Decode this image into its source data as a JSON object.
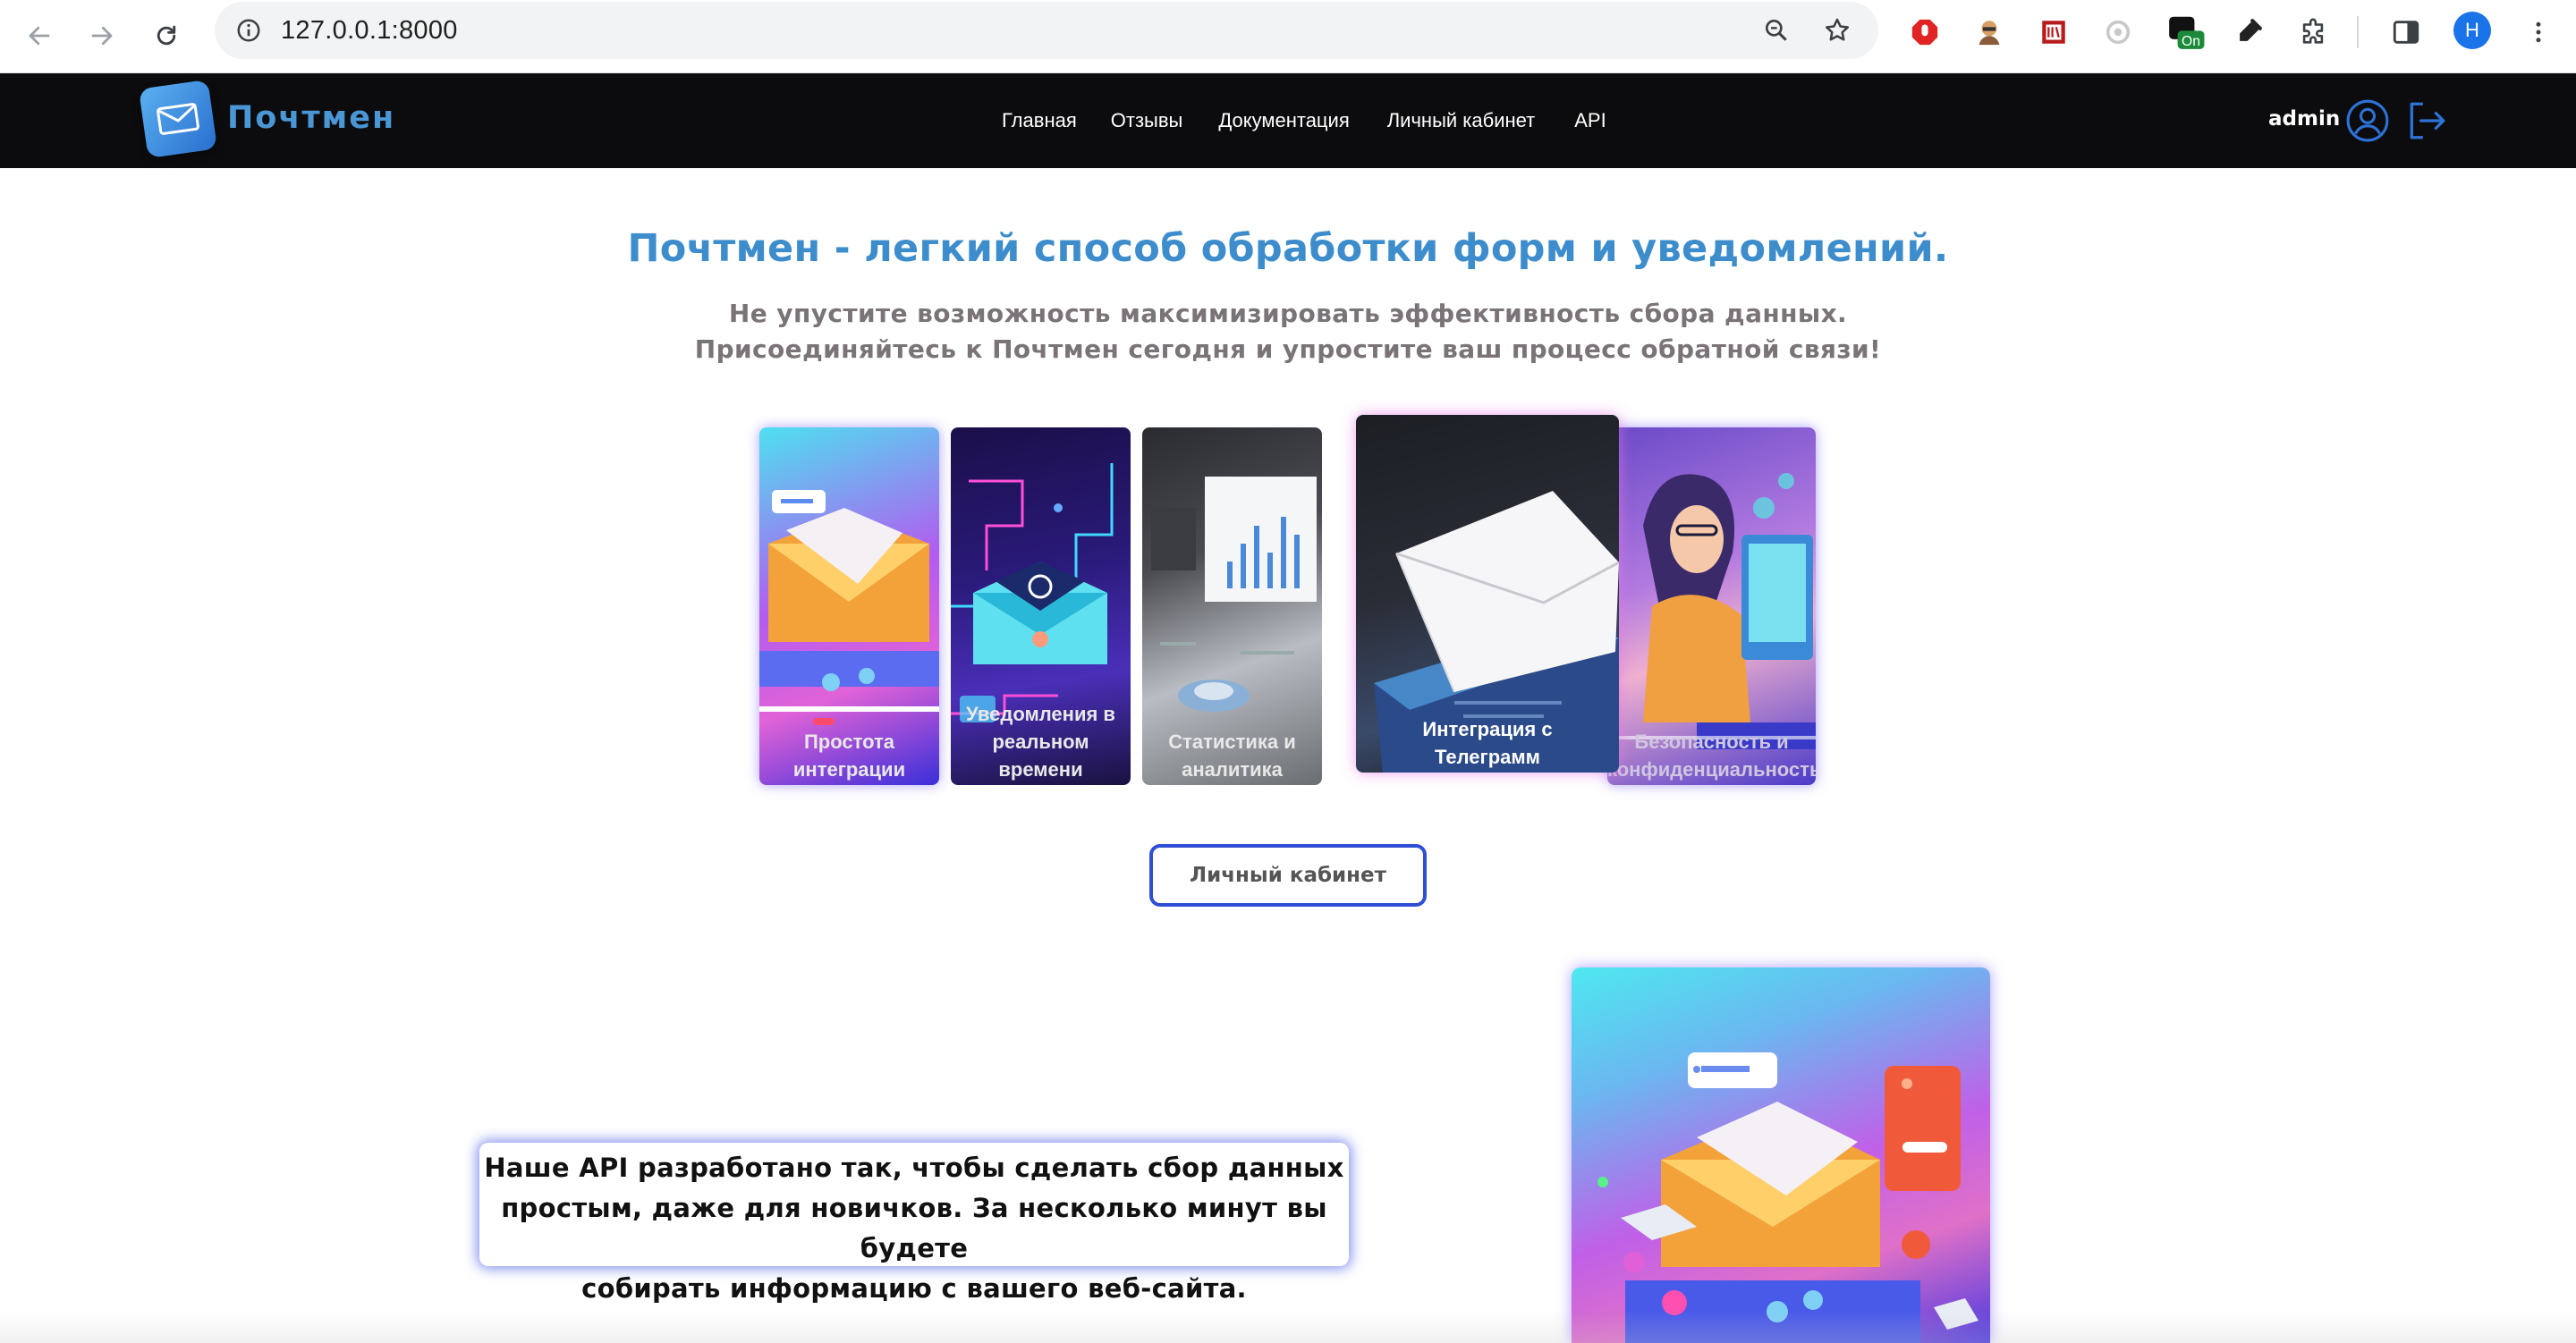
{
  "browser": {
    "url": "127.0.0.1:8000",
    "profile_initial": "H",
    "extension_badge": "On"
  },
  "header": {
    "brand": "Почтмен",
    "menu": [
      {
        "label": "Главная"
      },
      {
        "label": "Отзывы"
      },
      {
        "label": "Документация"
      },
      {
        "label": "Личный кабинет"
      },
      {
        "label": "API"
      }
    ],
    "username": "admin"
  },
  "hero": {
    "title": "Почтмен - легкий способ обработки форм и уведомлений.",
    "subtitle_line1": "Не упустите возможность максимизировать эффективность сбора данных.",
    "subtitle_line2": "Присоединяйтесь к Почтмен сегодня и упростите ваш процесс обратной связи!"
  },
  "features": [
    {
      "caption_line1": "Простота",
      "caption_line2": "интеграции",
      "caption_line3": ""
    },
    {
      "caption_line1": "Уведомления в",
      "caption_line2": "реальном",
      "caption_line3": "времени"
    },
    {
      "caption_line1": "Статистика и",
      "caption_line2": "аналитика",
      "caption_line3": ""
    },
    {
      "caption_line1": "Интеграция с",
      "caption_line2": "Телеграмм",
      "caption_line3": ""
    },
    {
      "caption_line1": "Безопасность и",
      "caption_line2": "конфиденциальность",
      "caption_line3": ""
    }
  ],
  "cta_label": "Личный кабинет",
  "api_info": {
    "line1": "Наше API разработано так, чтобы сделать сбор данных",
    "line2": "простым, даже для новичков. За несколько минут вы будете",
    "line3": "собирать информацию с вашего веб-сайта."
  },
  "colors": {
    "header_bg": "#0c0c0e",
    "brand": "#4a97d6",
    "title": "#3d8ccc",
    "cta_border": "#2f4ed6"
  }
}
